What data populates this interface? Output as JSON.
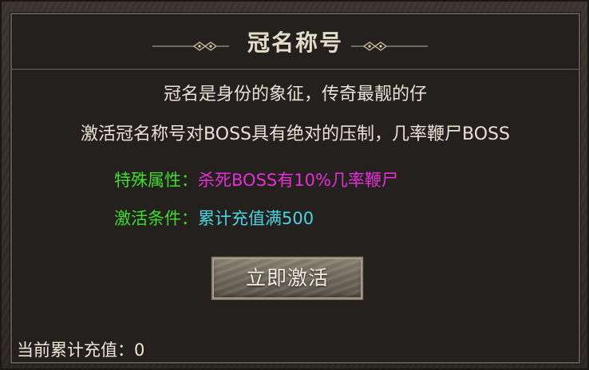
{
  "panel": {
    "title": "冠名称号",
    "description_line1": "冠名是身份的象征，传奇最靓的仔",
    "description_line2": "激活冠名称号对BOSS具有绝对的压制，几率鞭尸BOSS",
    "special_attribute": {
      "label": "特殊属性：",
      "value": "杀死BOSS有10%几率鞭尸",
      "value_color": "#e52fd7"
    },
    "activation_condition": {
      "label": "激活条件：",
      "value": "累计充值满500",
      "value_color": "#4bd3e0"
    },
    "label_color": "#3fdc2f",
    "activate_button_label": "立即激活",
    "current_recharge_label": "当前累计充值：",
    "current_recharge_value": "0"
  },
  "icons": [
    "title-ornament-left-icon",
    "title-ornament-right-icon"
  ]
}
